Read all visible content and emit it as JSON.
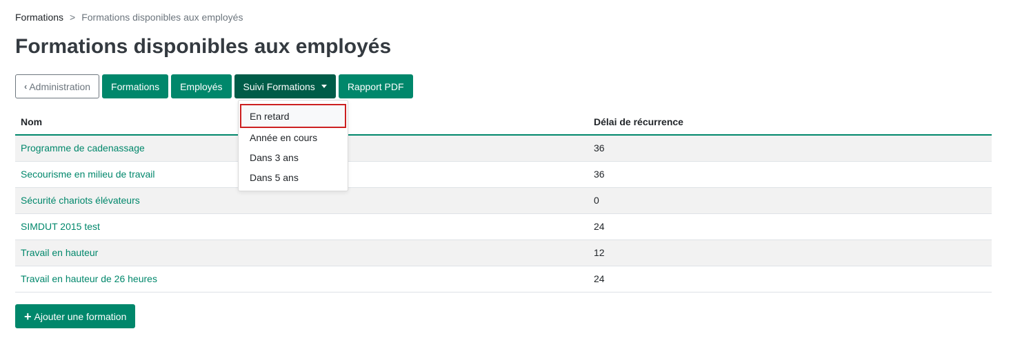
{
  "breadcrumb": {
    "parent": "Formations",
    "separator": ">",
    "current": "Formations disponibles aux employés"
  },
  "page_title": "Formations disponibles aux employés",
  "toolbar": {
    "admin_label": "Administration",
    "formations_label": "Formations",
    "employes_label": "Employés",
    "suivi_label": "Suivi Formations",
    "rapport_label": "Rapport PDF"
  },
  "dropdown": {
    "items": [
      "En retard",
      "Année en cours",
      "Dans 3 ans",
      "Dans 5 ans"
    ],
    "highlighted": "En retard"
  },
  "table": {
    "headers": {
      "nom": "Nom",
      "delai": "Délai de récurrence"
    },
    "rows": [
      {
        "nom": "Programme de cadenassage",
        "delai": "36"
      },
      {
        "nom": "Secourisme en milieu de travail",
        "delai": "36"
      },
      {
        "nom": "Sécurité chariots élévateurs",
        "delai": "0"
      },
      {
        "nom": "SIMDUT 2015 test",
        "delai": "24"
      },
      {
        "nom": "Travail en hauteur",
        "delai": "12"
      },
      {
        "nom": "Travail en hauteur de 26 heures",
        "delai": "24"
      }
    ]
  },
  "add_button_label": "Ajouter une formation",
  "colors": {
    "accent": "#00876b",
    "accent_dark": "#005c48",
    "highlight_border": "#cc1f1f"
  }
}
